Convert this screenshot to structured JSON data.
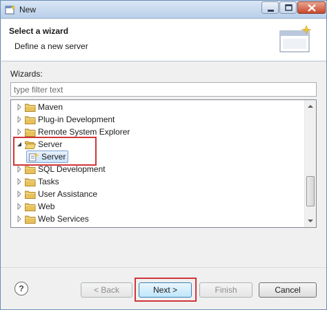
{
  "window": {
    "title": "New"
  },
  "header": {
    "title": "Select a wizard",
    "description": "Define a new server"
  },
  "wizards": {
    "label": "Wizards:",
    "filter_placeholder": "type filter text",
    "items": [
      {
        "label": "Maven",
        "state": "collapsed"
      },
      {
        "label": "Plug-in Development",
        "state": "collapsed"
      },
      {
        "label": "Remote System Explorer",
        "state": "collapsed"
      },
      {
        "label": "Server",
        "state": "expanded"
      },
      {
        "label": "SQL Development",
        "state": "collapsed"
      },
      {
        "label": "Tasks",
        "state": "collapsed"
      },
      {
        "label": "User Assistance",
        "state": "collapsed"
      },
      {
        "label": "Web",
        "state": "collapsed"
      },
      {
        "label": "Web Services",
        "state": "collapsed"
      }
    ],
    "selected_child": {
      "label": "Server",
      "parent": "Server"
    }
  },
  "footer": {
    "help": "?",
    "back": "< Back",
    "next": "Next >",
    "finish": "Finish",
    "cancel": "Cancel"
  },
  "colors": {
    "highlight": "#d13438",
    "selection": "#cde3fb",
    "folder": "#e8c25a"
  },
  "icons": {
    "folder": "folder-icon",
    "server": "server-wizard-icon",
    "help": "help-icon"
  }
}
